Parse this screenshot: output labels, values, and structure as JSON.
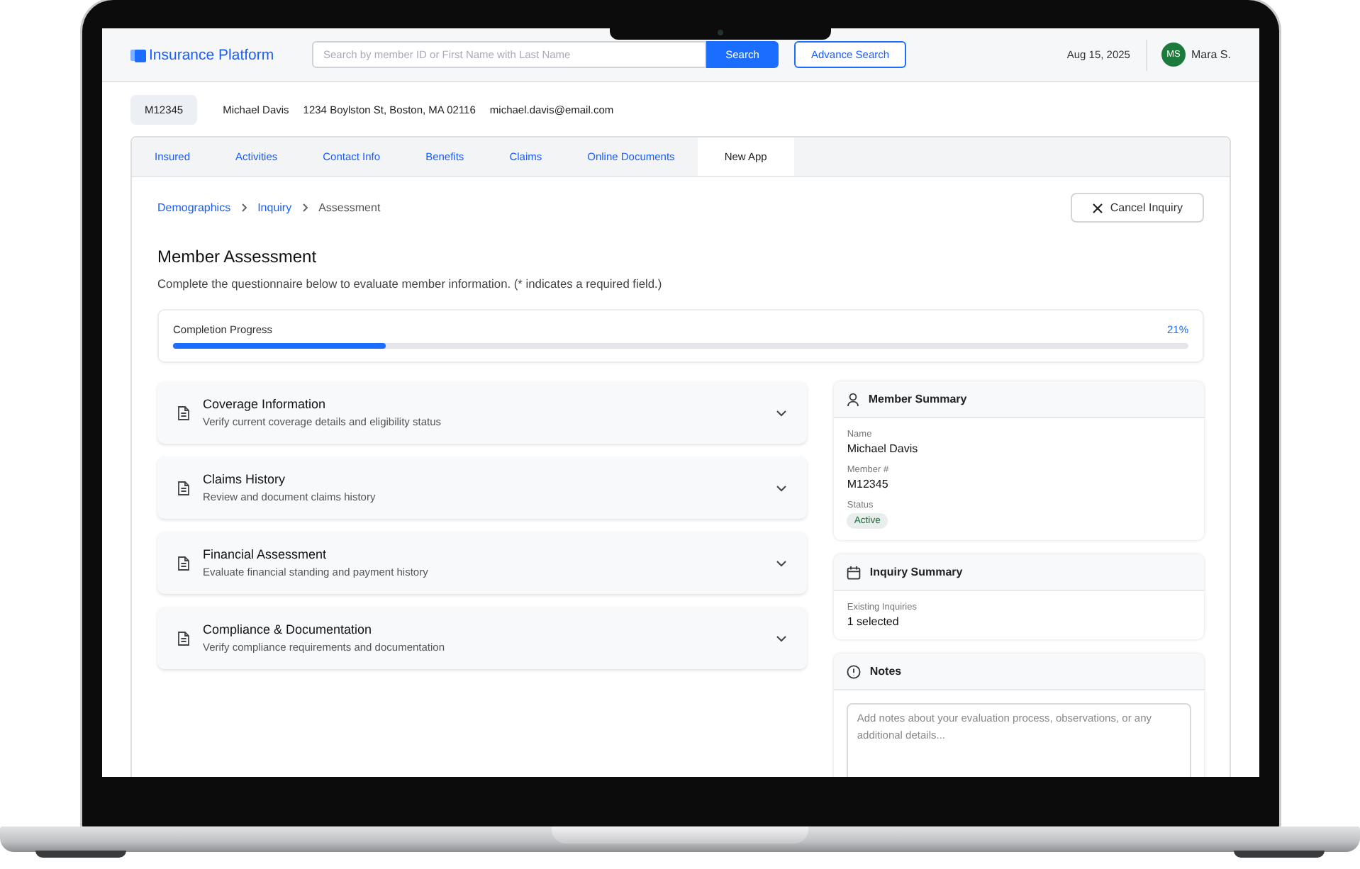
{
  "app": {
    "logo": "Insurance Platform",
    "search": {
      "placeholder": "Search by member ID or First Name with Last Name",
      "button": "Search"
    },
    "advance_search": "Advance Search",
    "date": "Aug 15, 2025",
    "user": {
      "initials": "MS",
      "name": "Mara S."
    }
  },
  "member_bar": {
    "id": "M12345",
    "name": "Michael Davis",
    "address": "1234 Boylston St, Boston, MA 02116",
    "email": "michael.davis@email.com"
  },
  "tabs": [
    {
      "label": "Insured",
      "selected": false
    },
    {
      "label": "Activities",
      "selected": false
    },
    {
      "label": "Contact Info",
      "selected": false
    },
    {
      "label": "Benefits",
      "selected": false
    },
    {
      "label": "Claims",
      "selected": false
    },
    {
      "label": "Online Documents",
      "selected": false
    },
    {
      "label": "New App",
      "selected": true
    }
  ],
  "breadcrumb": [
    {
      "label": "Demographics",
      "current": false
    },
    {
      "label": "Inquiry",
      "current": false
    },
    {
      "label": "Assessment",
      "current": true
    }
  ],
  "cancel_button": "Cancel Inquiry",
  "title": "Member Assessment",
  "description": "Complete the questionnaire below to evaluate member information. (* indicates a required field.)",
  "progress": {
    "label": "Completion Progress",
    "level": 0.21,
    "reading": "21%"
  },
  "sections": [
    {
      "title": "Coverage Information",
      "subtitle": "Verify current coverage details and eligibility status"
    },
    {
      "title": "Claims History",
      "subtitle": "Review and document claims history"
    },
    {
      "title": "Financial Assessment",
      "subtitle": "Evaluate financial standing and payment history"
    },
    {
      "title": "Compliance & Documentation",
      "subtitle": "Verify compliance requirements and documentation"
    }
  ],
  "member_summary": {
    "title": "Member Summary",
    "fields": [
      {
        "label": "Name",
        "value": "Michael Davis",
        "kind": "text"
      },
      {
        "label": "Member #",
        "value": "M12345",
        "kind": "text"
      },
      {
        "label": "Status",
        "value": "Active",
        "kind": "badge"
      }
    ]
  },
  "inquiry_summary": {
    "title": "Inquiry Summary",
    "fields": [
      {
        "label": "Existing Inquiries",
        "value": "1 selected",
        "kind": "text"
      }
    ]
  },
  "notes": {
    "title": "Notes",
    "placeholder": "Add notes about your evaluation process, observations, or any additional details..."
  }
}
